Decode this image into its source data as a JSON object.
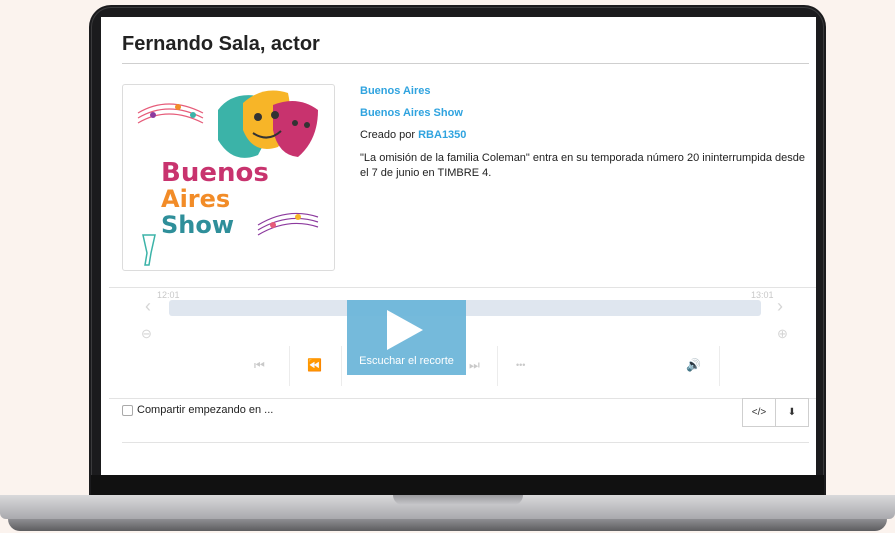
{
  "page": {
    "title": "Fernando Sala, actor"
  },
  "thumbnail": {
    "logo_text_line1": "Buenos",
    "logo_text_line2": "Aires",
    "logo_text_line3": "Show"
  },
  "info": {
    "location": "Buenos Aires",
    "program": "Buenos Aires Show",
    "created_by_prefix": "Creado por",
    "created_by_user": "RBA1350",
    "description": "\"La omisión de la familia Coleman\" entra en su temporada número 20 ininterrumpida desde el 7 de junio en TIMBRE 4."
  },
  "player": {
    "time_start": "12:01",
    "time_end": "13:01",
    "play_label": "Escuchar el recorte",
    "more_glyph": "•••"
  },
  "footer": {
    "share_label": "Compartir empezando en ...",
    "embed_label": "</>",
    "download_glyph": "⬇"
  },
  "colors": {
    "link": "#2fa3df",
    "play_overlay": "#6eb7da",
    "timebar": "#dfe6ef"
  },
  "icons": [
    "prev-icon",
    "rewind-icon",
    "forward-icon",
    "next-icon",
    "more-icon",
    "volume-icon",
    "zoom-out-icon",
    "zoom-in-icon",
    "play-icon",
    "embed-icon",
    "download-icon"
  ]
}
